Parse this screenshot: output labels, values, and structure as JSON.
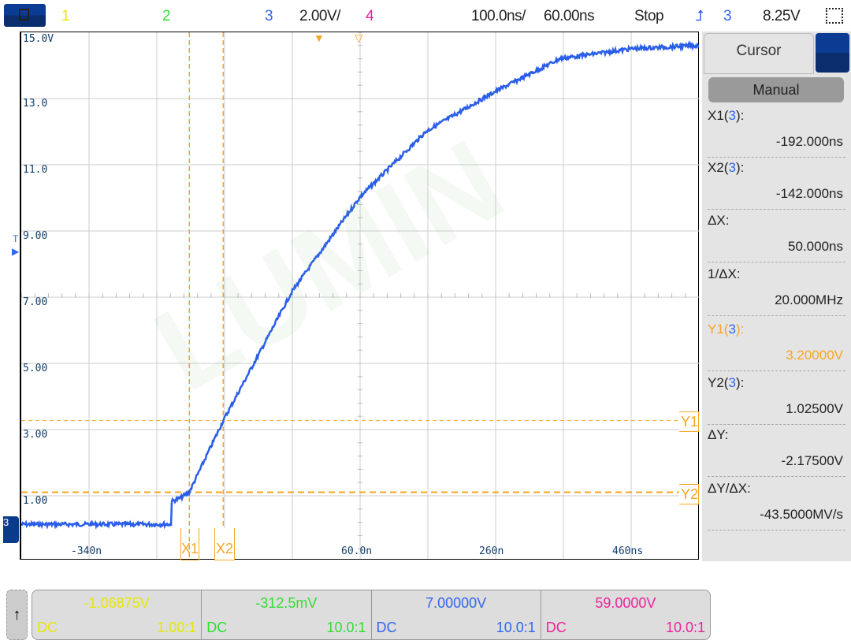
{
  "header": {
    "ch1": "1",
    "ch2": "2",
    "ch3": "3",
    "scale": "2.00V/",
    "ch4": "4",
    "timebase": "100.0ns/",
    "delay": "60.00ns",
    "run_state": "Stop",
    "trigger_source": "3",
    "trigger_level": "8.25V",
    "menu_icon": "menu-icon",
    "zoom_icon": "select-box-icon"
  },
  "colors": {
    "ch1": "#e8e800",
    "ch2": "#33dd33",
    "ch3": "#3366ee",
    "ch4": "#ee2299",
    "cursor": "#f5a623",
    "waveform": "#2a5ee8"
  },
  "plot": {
    "y_labels": [
      "15.0V",
      "13.0",
      "11.0",
      "9.00",
      "7.00",
      "5.00",
      "3.00",
      "1.00"
    ],
    "x_labels": [
      "-340n",
      "60.0n",
      "260n",
      "460ns"
    ],
    "x1_label": "X1",
    "x2_label": "X2",
    "y1_label": "Y1",
    "y2_label": "Y2",
    "ground_marker": "3",
    "trigger_marker": "T",
    "watermark": "LUMIN"
  },
  "waveform": {
    "time_ns": [
      -440,
      -219,
      -218,
      -205,
      -192,
      -142,
      -90,
      -40,
      60,
      158,
      259,
      355,
      460,
      561
    ],
    "volts": [
      0.05,
      0.05,
      0.75,
      0.85,
      1.03,
      3.2,
      5.2,
      7.14,
      10.0,
      12.0,
      13.2,
      14.2,
      14.5,
      14.6
    ]
  },
  "cursor_panel": {
    "tab": "Cursor",
    "mode": "Manual",
    "rows": [
      {
        "label": "X1",
        "src": "3",
        "value": "-192.000ns"
      },
      {
        "label": "X2",
        "src": "3",
        "value": "-142.000ns"
      },
      {
        "label": "ΔX:",
        "src": "",
        "value": "50.000ns"
      },
      {
        "label": "1/ΔX:",
        "src": "",
        "value": "20.000MHz"
      },
      {
        "label": "Y1",
        "src": "3",
        "value": "3.20000V",
        "highlight": true
      },
      {
        "label": "Y2",
        "src": "3",
        "value": "1.02500V"
      },
      {
        "label": "ΔY:",
        "src": "",
        "value": "-2.17500V"
      },
      {
        "label": "ΔY/ΔX:",
        "src": "",
        "value": "-43.5000MV/s"
      }
    ]
  },
  "channels": [
    {
      "offset": "-1.06875V",
      "coupling": "DC",
      "probe": "1.00:1",
      "color": "#e8e800"
    },
    {
      "offset": "-312.5mV",
      "coupling": "DC",
      "probe": "10.0:1",
      "color": "#33dd33"
    },
    {
      "offset": "7.00000V",
      "coupling": "DC",
      "probe": "10.0:1",
      "color": "#3366ee"
    },
    {
      "offset": "59.0000V",
      "coupling": "DC",
      "probe": "10.0:1",
      "color": "#ee2299"
    }
  ],
  "scroll_button": "↑"
}
